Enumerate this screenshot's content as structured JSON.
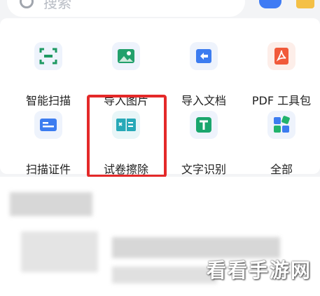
{
  "search": {
    "placeholder": "搜索"
  },
  "tools": [
    {
      "label": "智能扫描",
      "icon": "scan-icon",
      "color": "#1f9a63"
    },
    {
      "label": "导入图片",
      "icon": "image-icon",
      "color": "#22a06b"
    },
    {
      "label": "导入文档",
      "icon": "import-doc-icon",
      "color": "#3c7cf0"
    },
    {
      "label": "PDF 工具包",
      "icon": "pdf-icon",
      "color": "#f15a3a"
    },
    {
      "label": "扫描证件",
      "icon": "id-card-icon",
      "color": "#3c7cf0"
    },
    {
      "label": "试卷擦除",
      "icon": "exam-erase-icon",
      "color": "#27a9b8"
    },
    {
      "label": "文字识别",
      "icon": "text-recognition-icon",
      "color": "#1aa66d"
    },
    {
      "label": "全部",
      "icon": "all-apps-icon",
      "color": "#3c7cf0"
    }
  ],
  "highlight_color": "#e42929",
  "watermark": "看看手游网"
}
